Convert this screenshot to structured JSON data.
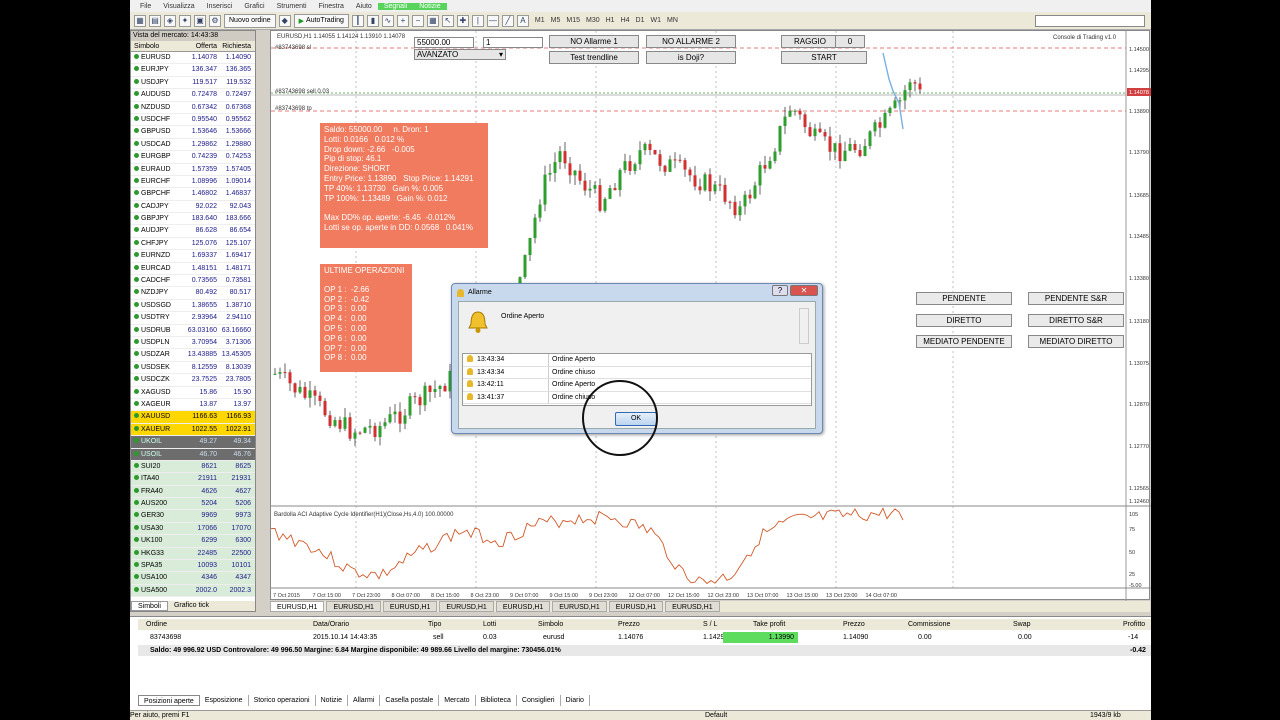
{
  "menu": [
    "File",
    "Visualizza",
    "Inserisci",
    "Grafici",
    "Strumenti",
    "Finestra",
    "Aiuto",
    "Segnali",
    "Notizie"
  ],
  "toolbar": {
    "new_order": "Nuovo ordine",
    "autotrading": "AutoTrading",
    "timeframes": [
      "M1",
      "M5",
      "M15",
      "M30",
      "H1",
      "H4",
      "D1",
      "W1",
      "MN"
    ]
  },
  "market_watch": {
    "title": "Vista del mercato: 14:43:38",
    "headers": [
      "Simbolo",
      "Offerta",
      "Richiesta"
    ],
    "rows": [
      [
        "EURUSD",
        "1.14078",
        "1.14090"
      ],
      [
        "EURJPY",
        "136.347",
        "136.365"
      ],
      [
        "USDJPY",
        "119.517",
        "119.532"
      ],
      [
        "AUDUSD",
        "0.72478",
        "0.72497"
      ],
      [
        "NZDUSD",
        "0.67342",
        "0.67368"
      ],
      [
        "USDCHF",
        "0.95540",
        "0.95562"
      ],
      [
        "GBPUSD",
        "1.53646",
        "1.53666"
      ],
      [
        "USDCAD",
        "1.29862",
        "1.29880"
      ],
      [
        "EURGBP",
        "0.74239",
        "0.74253"
      ],
      [
        "EURAUD",
        "1.57359",
        "1.57405"
      ],
      [
        "EURCHF",
        "1.08996",
        "1.09014"
      ],
      [
        "GBPCHF",
        "1.46802",
        "1.46837"
      ],
      [
        "CADJPY",
        "92.022",
        "92.043"
      ],
      [
        "GBPJPY",
        "183.640",
        "183.666"
      ],
      [
        "AUDJPY",
        "86.628",
        "86.654"
      ],
      [
        "CHFJPY",
        "125.076",
        "125.107"
      ],
      [
        "EURNZD",
        "1.69337",
        "1.69417"
      ],
      [
        "EURCAD",
        "1.48151",
        "1.48171"
      ],
      [
        "CADCHF",
        "0.73565",
        "0.73581"
      ],
      [
        "NZDJPY",
        "80.492",
        "80.517"
      ],
      [
        "USDSGD",
        "1.38655",
        "1.38710"
      ],
      [
        "USDTRY",
        "2.93964",
        "2.94110"
      ],
      [
        "USDRUB",
        "63.03160",
        "63.16660"
      ],
      [
        "USDPLN",
        "3.70954",
        "3.71306"
      ],
      [
        "USDZAR",
        "13.43885",
        "13.45305"
      ],
      [
        "USDSEK",
        "8.12559",
        "8.13039"
      ],
      [
        "USDCZK",
        "23.7525",
        "23.7805"
      ],
      [
        "XAGUSD",
        "15.86",
        "15.90"
      ],
      [
        "XAGEUR",
        "13.87",
        "13.97"
      ],
      [
        "XAUUSD",
        "1166.63",
        "1166.93"
      ],
      [
        "XAUEUR",
        "1022.55",
        "1022.91"
      ],
      [
        "UKOIL",
        "49.27",
        "49.34"
      ],
      [
        "USOIL",
        "46.70",
        "46.76"
      ],
      [
        "SUI20",
        "8621",
        "8625"
      ],
      [
        "ITA40",
        "21911",
        "21931"
      ],
      [
        "FRA40",
        "4626",
        "4627"
      ],
      [
        "AUS200",
        "5204",
        "5206"
      ],
      [
        "GER30",
        "9969",
        "9973"
      ],
      [
        "USA30",
        "17066",
        "17070"
      ],
      [
        "UK100",
        "6299",
        "6300"
      ],
      [
        "HKG33",
        "22485",
        "22500"
      ],
      [
        "SPA35",
        "10093",
        "10101"
      ],
      [
        "USA100",
        "4346",
        "4347"
      ],
      [
        "USA500",
        "2002.0",
        "2002.3"
      ]
    ],
    "tabs": [
      "Simboli",
      "Grafico tick"
    ]
  },
  "chart": {
    "symbol_caption": "EURUSD,H1  1.14055 1.14124 1.13910 1.14078",
    "order_label_1": "#83743698 sl",
    "order_label_2": "#83743698 sell 0.03",
    "order_label_3": "#83743698 tp",
    "console_label": "Console di Trading v1.0",
    "amount_input": "55000.00",
    "qty_input": "1",
    "mode_select": "AVANZATO",
    "buttons": {
      "alarm1": "NO Allarme 1",
      "alarm2": "NO ALLARME 2",
      "raggio": "RAGGIO",
      "zero": "0",
      "trendline": "Test trendline",
      "doji": "is Doji?",
      "start": "START",
      "pendente": "PENDENTE",
      "pendente_sr": "PENDENTE S&R",
      "diretto": "DIRETTO",
      "diretto_sr": "DIRETTO S&R",
      "mediato_pendente": "MEDIATO PENDENTE",
      "mediato_diretto": "MEDIATO DIRETTO"
    },
    "info_box": [
      "Saldo: 55000.00     n. Dron: 1",
      "Lotti: 0.0166   0.012 %",
      "Drop down: -2.66   -0.005",
      "Pip di stop: 46.1",
      "Direzione: SHORT",
      "Entry Price: 1.13890   Stop Price: 1.14291",
      "TP 40%: 1.13730   Gain %: 0.005",
      "TP 100%: 1.13489   Gain %: 0.012",
      "",
      "Max DD% op. aperte: -6.45  -0.012%",
      "Lotti se op. aperte in DD: 0.0568   0.041%"
    ],
    "last_ops_title": "ULTIME OPERAZIONI",
    "last_ops": [
      "OP 1 :  -2.66",
      "OP 2 :  -0.42",
      "OP 3 :  0.00",
      "OP 4 :  0.00",
      "OP 5 :  0.00",
      "OP 6 :  0.00",
      "OP 7 :  0.00",
      "OP 8 :  0.00"
    ],
    "price_ticks": [
      "1.14500",
      "1.14295",
      "1.14078",
      "1.13890",
      "1.13790",
      "1.13685",
      "1.13485",
      "1.13380",
      "1.13180",
      "1.13075",
      "1.12870",
      "1.12770",
      "1.12565",
      "1.12460",
      "1.12260",
      "1.12155"
    ],
    "current_price": "1.14078",
    "time_ticks": [
      "7 Oct 2015",
      "7 Oct 15:00",
      "7 Oct 23:00",
      "8 Oct 07:00",
      "8 Oct 15:00",
      "8 Oct 23:00",
      "9 Oct 07:00",
      "9 Oct 15:00",
      "9 Oct 23:00",
      "12 Oct 07:00",
      "12 Oct 15:00",
      "12 Oct 23:00",
      "13 Oct 07:00",
      "13 Oct 15:00",
      "13 Oct 23:00",
      "14 Oct 07:00"
    ],
    "indicator_caption": "Bardolla ACI Adaptive Cycle Identifier(H1)(Close,Hs,4.0) 100.00000",
    "indicator_ticks": [
      "105",
      "75",
      "50",
      "25",
      "-5.00"
    ],
    "tabs": [
      "EURUSD,H1",
      "EURUSD,H1",
      "EURUSD,H1",
      "EURUSD,H1",
      "EURUSD,H1",
      "EURUSD,H1",
      "EURUSD,H1",
      "EURUSD,H1"
    ]
  },
  "dialog": {
    "title": "Allarme",
    "message": "Ordine Aperto",
    "list": [
      [
        "13:43:34",
        "Ordine Aperto"
      ],
      [
        "13:43:34",
        "Ordine chiuso"
      ],
      [
        "13:42:11",
        "Ordine Aperto"
      ],
      [
        "13:41:37",
        "Ordine chiuso"
      ]
    ],
    "ok_label": "OK"
  },
  "terminal": {
    "headers": [
      "Ordine",
      "Data/Orario",
      "Tipo",
      "Lotti",
      "Simbolo",
      "Prezzo",
      "S / L",
      "Take profit",
      "Prezzo",
      "Commissione",
      "Swap",
      "Profitto"
    ],
    "row": [
      "83743698",
      "2015.10.14 14:43:35",
      "sell",
      "0.03",
      "eurusd",
      "1.14076",
      "1.14291",
      "1.13990",
      "1.14090",
      "0.00",
      "0.00",
      "-14"
    ],
    "balance": "Saldo: 49 996.92 USD  Controvalore: 49 996.50  Margine: 6.84  Margine disponibile: 49 989.66  Livello del margine: 730456.01%",
    "balance_profit": "-0.42",
    "tabs": [
      "Posizioni aperte",
      "Esposizione",
      "Storico operazioni",
      "Notizie",
      "Allarmi",
      "Casella postale",
      "Mercato",
      "Biblioteca",
      "Consiglieri",
      "Diario"
    ]
  },
  "status": {
    "help": "Per aiuto, premi F1",
    "profile": "Default",
    "traffic": "1943/9 kb"
  },
  "colors": {
    "info_box": "#f07b5f",
    "tp_highlight": "#5edc5e",
    "gold_row": "#ffd700"
  }
}
